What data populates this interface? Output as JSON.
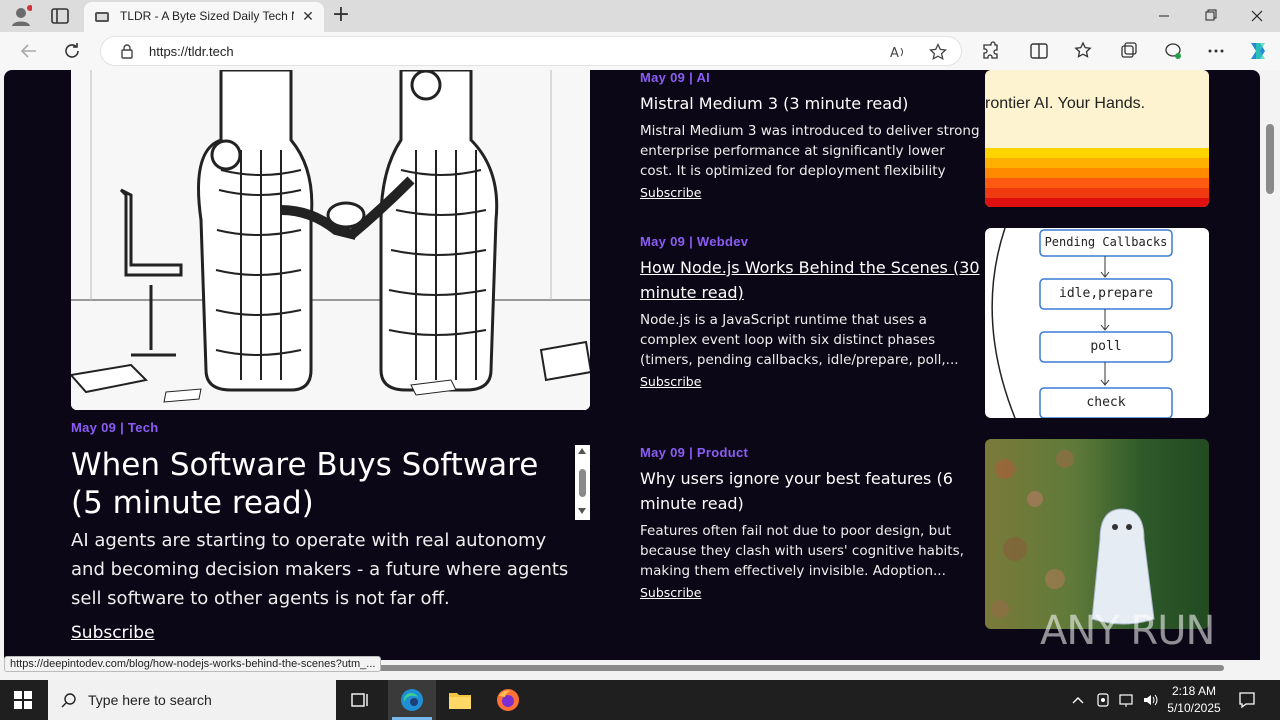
{
  "browser": {
    "tab_title": "TLDR - A Byte Sized Daily Tech Ne",
    "url": "https://tldr.tech"
  },
  "hero": {
    "category": "May 09 | Tech",
    "title": "When Software Buys Software (5 minute read)",
    "description": "AI agents are starting to operate with real autonomy and becoming decision makers - a future where agents sell software to other agents is not far off.",
    "subscribe": "Subscribe"
  },
  "articles": [
    {
      "category": "May 09 | AI",
      "title": "Mistral Medium 3 (3 minute read)",
      "description": "Mistral Medium 3 was introduced to deliver strong enterprise performance at significantly lower cost. It is optimized for deployment flexibility and...",
      "subscribe": "Subscribe",
      "image_text": "rontier AI. Your Hands."
    },
    {
      "category": "May 09 | Webdev",
      "title": "How Node.js Works Behind the Scenes (30 minute read)",
      "description": "Node.js is a JavaScript runtime that uses a complex event loop with six distinct phases (timers, pending callbacks, idle/prepare, poll,...",
      "subscribe": "Subscribe",
      "diagram": [
        "Pending Callbacks",
        "idle,prepare",
        "poll",
        "check"
      ]
    },
    {
      "category": "May 09 | Product",
      "title": "Why users ignore your best features (6 minute read)",
      "description": "Features often fail not due to poor design, but because they clash with users' cognitive habits, making them effectively invisible. Adoption...",
      "subscribe": "Subscribe"
    }
  ],
  "status_url": "https://deepintodev.com/blog/how-nodejs-works-behind-the-scenes?utm_...",
  "taskbar": {
    "search_placeholder": "Type here to search",
    "time": "2:18 AM",
    "date": "5/10/2025"
  },
  "watermark": "ANY RUN"
}
